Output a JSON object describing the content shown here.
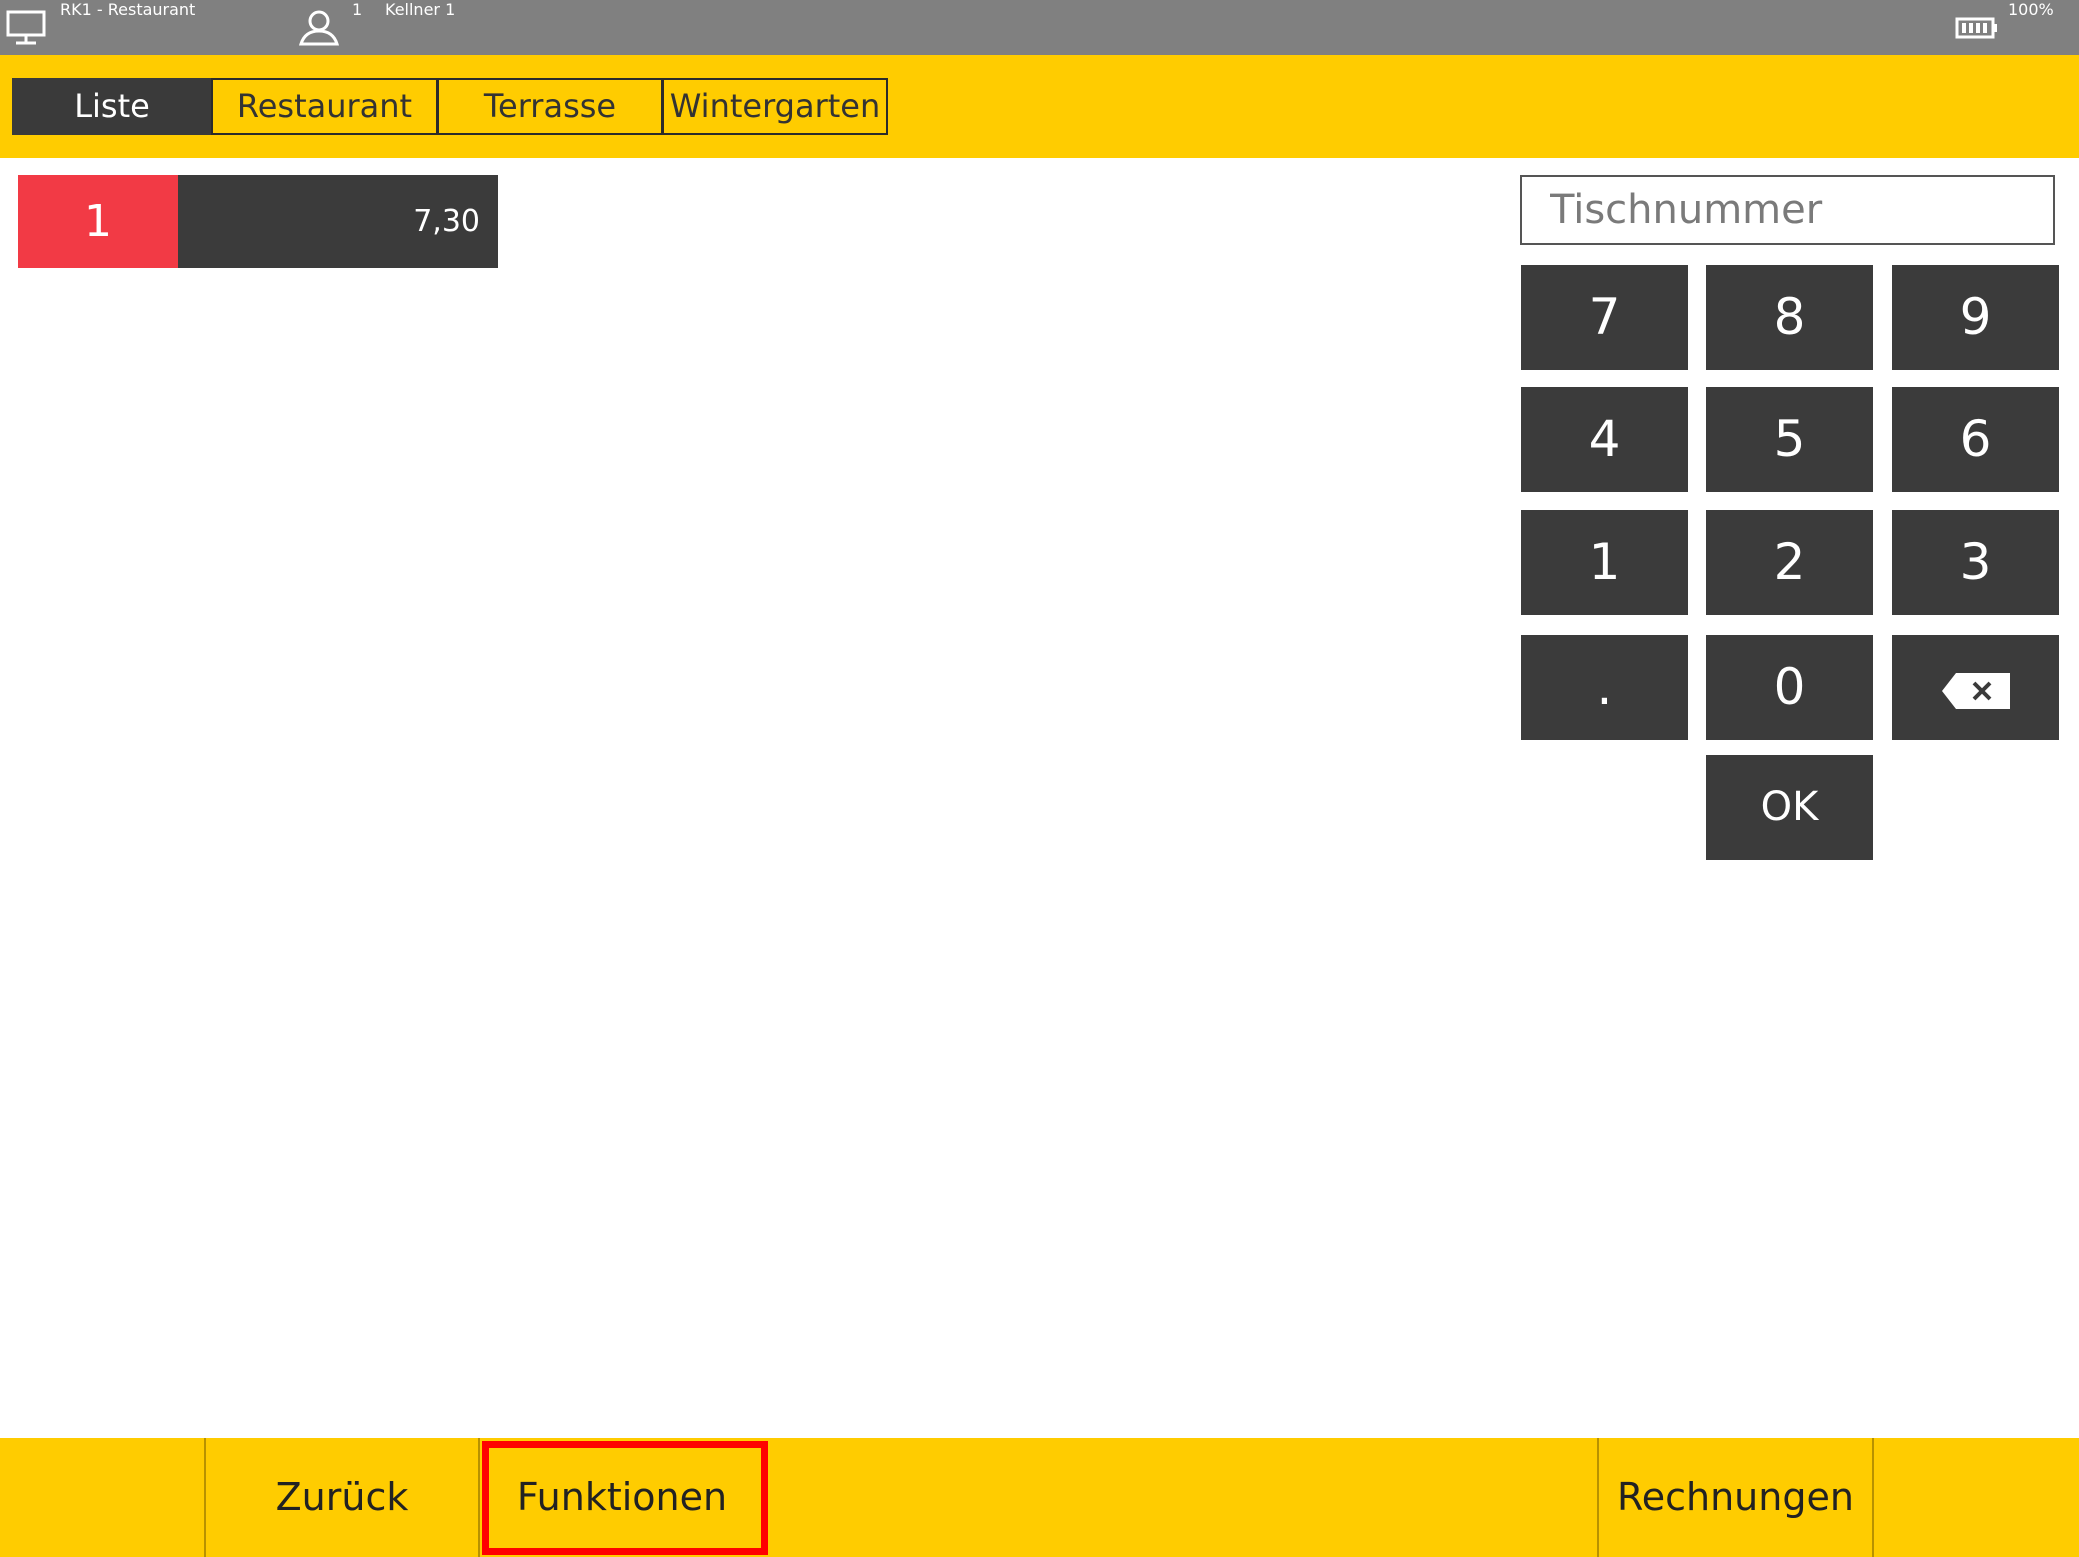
{
  "titlebar": {
    "title": "RK1 - Restaurant",
    "user_number": "1",
    "user_name": "Kellner 1",
    "battery": "100%",
    "icons": [
      "monitor-icon",
      "user-icon",
      "battery-icon"
    ]
  },
  "tabs": [
    {
      "label": "Liste",
      "active": true
    },
    {
      "label": "Restaurant",
      "active": false
    },
    {
      "label": "Terrasse",
      "active": false
    },
    {
      "label": "Wintergarten",
      "active": false
    }
  ],
  "tables": [
    {
      "number": "1",
      "amount": "7,30"
    }
  ],
  "table_input": {
    "placeholder": "Tischnummer",
    "value": ""
  },
  "keypad": {
    "keys": [
      "7",
      "8",
      "9",
      "4",
      "5",
      "6",
      "1",
      "2",
      "3",
      ".",
      "0"
    ],
    "backspace_icon": "backspace-icon",
    "ok_label": "OK"
  },
  "bottom": {
    "back_label": "Zurück",
    "functions_label": "Funktionen",
    "invoices_label": "Rechnungen"
  },
  "colors": {
    "accent_yellow": "#ffcc00",
    "dark": "#3b3b3b",
    "table_red": "#f23a45",
    "titlebar_gray": "#808080",
    "highlight_red": "#ff0000"
  }
}
